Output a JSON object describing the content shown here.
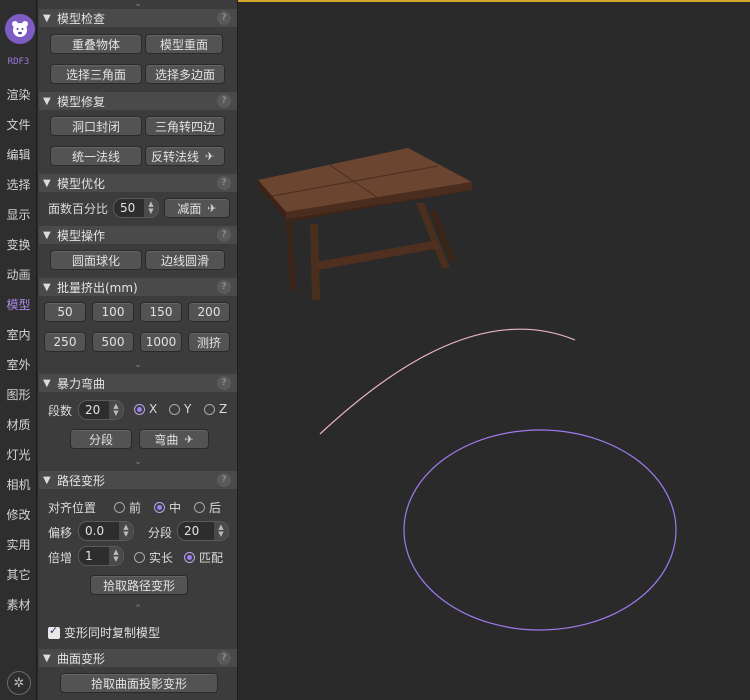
{
  "nav": {
    "brand": "RDF3",
    "items": [
      "渲染",
      "文件",
      "编辑",
      "选择",
      "显示",
      "变换",
      "动画",
      "模型",
      "室内",
      "室外",
      "图形",
      "材质",
      "灯光",
      "相机",
      "修改",
      "实用",
      "其它",
      "素材"
    ],
    "active": "模型"
  },
  "panel": {
    "check": {
      "title": "模型检查",
      "buttons": [
        "重叠物体",
        "模型重面",
        "选择三角面",
        "选择多边面"
      ]
    },
    "repair": {
      "title": "模型修复",
      "buttons": [
        "洞口封闭",
        "三角转四边",
        "统一法线",
        "反转法线"
      ]
    },
    "optimize": {
      "title": "模型优化",
      "label": "面数百分比",
      "value": "50",
      "button": "减面"
    },
    "operate": {
      "title": "模型操作",
      "buttons": [
        "圆面球化",
        "边线圆滑"
      ]
    },
    "extrude": {
      "title": "批量挤出(mm)",
      "buttons": [
        "50",
        "100",
        "150",
        "200",
        "250",
        "500",
        "1000",
        "测挤"
      ]
    },
    "bend": {
      "title": "暴力弯曲",
      "label": "段数",
      "value": "20",
      "axes": [
        "X",
        "Y",
        "Z"
      ],
      "selected_axis": "X",
      "buttons": [
        "分段",
        "弯曲"
      ]
    },
    "path": {
      "title": "路径变形",
      "align_label": "对齐位置",
      "align_options": [
        "前",
        "中",
        "后"
      ],
      "selected_align": "中",
      "offset_label": "偏移",
      "offset_value": "0.0",
      "seg_label": "分段",
      "seg_value": "20",
      "mult_label": "倍增",
      "mult_value": "1",
      "mode_options": [
        "实长",
        "匹配"
      ],
      "selected_mode": "匹配",
      "pick_button": "拾取路径变形"
    },
    "copy_check": "变形同时复制模型",
    "surface": {
      "title": "曲面变形",
      "button": "拾取曲面投影变形"
    }
  },
  "colors": {
    "accent": "#9c7ff0",
    "viewport_border": "#d3a82b",
    "curve": "#e8b4c8",
    "ellipse": "#a07af0"
  }
}
